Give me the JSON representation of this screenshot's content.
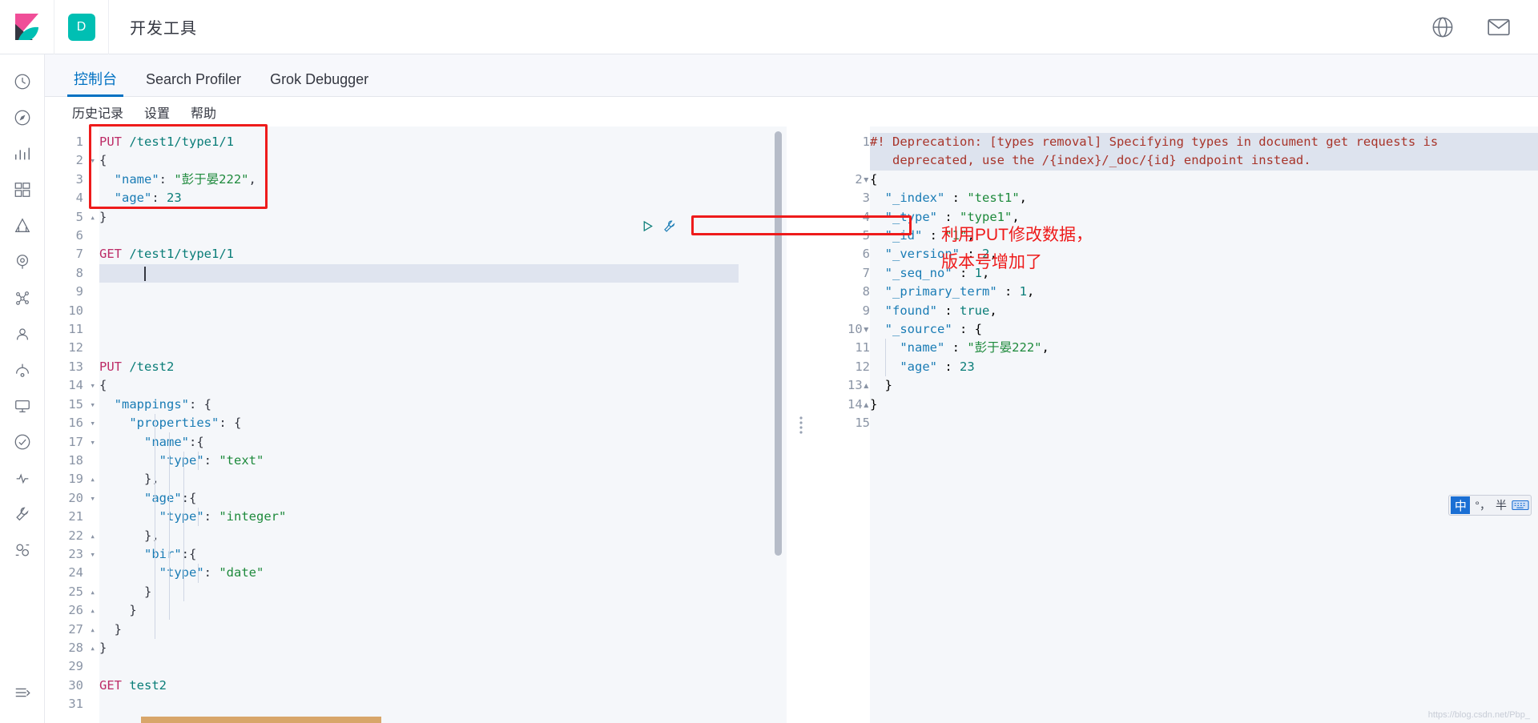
{
  "header": {
    "logo_name": "kibana-logo",
    "space_badge": "D",
    "title": "开发工具",
    "icons": [
      "help-circle-icon",
      "mail-icon"
    ]
  },
  "sidebar": {
    "items": [
      {
        "name": "recently-viewed-icon"
      },
      {
        "name": "discover-icon"
      },
      {
        "name": "visualize-icon"
      },
      {
        "name": "dashboard-icon"
      },
      {
        "name": "canvas-icon"
      },
      {
        "name": "maps-icon"
      },
      {
        "name": "machine-learning-icon"
      },
      {
        "name": "infrastructure-icon"
      },
      {
        "name": "logs-icon"
      },
      {
        "name": "apm-icon"
      },
      {
        "name": "uptime-icon"
      },
      {
        "name": "siem-icon"
      },
      {
        "name": "dev-tools-icon"
      },
      {
        "name": "management-icon"
      },
      {
        "name": "collapse-nav-icon"
      }
    ]
  },
  "tabs": [
    {
      "label": "控制台",
      "active": true
    },
    {
      "label": "Search Profiler",
      "active": false
    },
    {
      "label": "Grok Debugger",
      "active": false
    }
  ],
  "submenu": [
    {
      "label": "历史记录"
    },
    {
      "label": "设置"
    },
    {
      "label": "帮助"
    }
  ],
  "editor": {
    "total_lines": 31,
    "current_line": 8,
    "lines": [
      {
        "n": 1,
        "fold": "",
        "text": "PUT /test1/type1/1"
      },
      {
        "n": 2,
        "fold": "▾",
        "text": "{"
      },
      {
        "n": 3,
        "fold": "",
        "text": "  \"name\": \"彭于晏222\","
      },
      {
        "n": 4,
        "fold": "",
        "text": "  \"age\": 23"
      },
      {
        "n": 5,
        "fold": "▴",
        "text": "}"
      },
      {
        "n": 6,
        "fold": "",
        "text": ""
      },
      {
        "n": 7,
        "fold": "",
        "text": "GET /test1/type1/1"
      },
      {
        "n": 8,
        "fold": "",
        "text": ""
      },
      {
        "n": 9,
        "fold": "",
        "text": ""
      },
      {
        "n": 10,
        "fold": "",
        "text": ""
      },
      {
        "n": 11,
        "fold": "",
        "text": ""
      },
      {
        "n": 12,
        "fold": "",
        "text": ""
      },
      {
        "n": 13,
        "fold": "",
        "text": "PUT /test2"
      },
      {
        "n": 14,
        "fold": "▾",
        "text": "{"
      },
      {
        "n": 15,
        "fold": "▾",
        "text": "  \"mappings\": {"
      },
      {
        "n": 16,
        "fold": "▾",
        "text": "    \"properties\": {"
      },
      {
        "n": 17,
        "fold": "▾",
        "text": "      \"name\":{"
      },
      {
        "n": 18,
        "fold": "",
        "text": "        \"type\": \"text\""
      },
      {
        "n": 19,
        "fold": "▴",
        "text": "      },"
      },
      {
        "n": 20,
        "fold": "▾",
        "text": "      \"age\":{"
      },
      {
        "n": 21,
        "fold": "",
        "text": "        \"type\": \"integer\""
      },
      {
        "n": 22,
        "fold": "▴",
        "text": "      },"
      },
      {
        "n": 23,
        "fold": "▾",
        "text": "      \"bir\":{"
      },
      {
        "n": 24,
        "fold": "",
        "text": "        \"type\": \"date\""
      },
      {
        "n": 25,
        "fold": "▴",
        "text": "      }"
      },
      {
        "n": 26,
        "fold": "▴",
        "text": "    }"
      },
      {
        "n": 27,
        "fold": "▴",
        "text": "  }"
      },
      {
        "n": 28,
        "fold": "▴",
        "text": "}"
      },
      {
        "n": 29,
        "fold": "",
        "text": ""
      },
      {
        "n": 30,
        "fold": "",
        "text": "GET test2"
      },
      {
        "n": 31,
        "fold": "",
        "text": ""
      }
    ],
    "action_icons": [
      "play-request-icon",
      "wrench-icon"
    ]
  },
  "output": {
    "total_lines": 15,
    "lines": [
      {
        "n": 1,
        "fold": "",
        "text": "#! Deprecation: [types removal] Specifying types in document get requests is"
      },
      {
        "n": "",
        "fold": "",
        "text": "   deprecated, use the /{index}/_doc/{id} endpoint instead."
      },
      {
        "n": 2,
        "fold": "▾",
        "text": "{"
      },
      {
        "n": 3,
        "fold": "",
        "text": "  \"_index\" : \"test1\","
      },
      {
        "n": 4,
        "fold": "",
        "text": "  \"_type\" : \"type1\","
      },
      {
        "n": 5,
        "fold": "",
        "text": "  \"_id\" : \"1\","
      },
      {
        "n": 6,
        "fold": "",
        "text": "  \"_version\" : 2,"
      },
      {
        "n": 7,
        "fold": "",
        "text": "  \"_seq_no\" : 1,"
      },
      {
        "n": 8,
        "fold": "",
        "text": "  \"_primary_term\" : 1,"
      },
      {
        "n": 9,
        "fold": "",
        "text": "  \"found\" : true,"
      },
      {
        "n": 10,
        "fold": "▾",
        "text": "  \"_source\" : {"
      },
      {
        "n": 11,
        "fold": "",
        "text": "    \"name\" : \"彭于晏222\","
      },
      {
        "n": 12,
        "fold": "",
        "text": "    \"age\" : 23"
      },
      {
        "n": 13,
        "fold": "▴",
        "text": "  }"
      },
      {
        "n": 14,
        "fold": "▴",
        "text": "}"
      },
      {
        "n": 15,
        "fold": "",
        "text": ""
      }
    ]
  },
  "annotations": {
    "box_request_name": "red-box-put-request",
    "box_version_name": "red-box-version-field",
    "note_line1": "利用PUT修改数据，",
    "note_line2": "版本号增加了",
    "color": "#ee1b1b"
  },
  "ime": {
    "mode": "中",
    "punct": "°，",
    "width_mode": "半",
    "keyboard_icon": "keyboard-icon"
  },
  "watermark": "https://blog.csdn.net/Pbp_",
  "colors": {
    "accent": "#0071c2",
    "space_badge": "#00bfb3",
    "method": "#bd2c67",
    "url": "#0a7d78",
    "key": "#1a7cb5",
    "string": "#1e8a3c",
    "warning": "#a8342a",
    "annotation": "#ee1b1b"
  }
}
